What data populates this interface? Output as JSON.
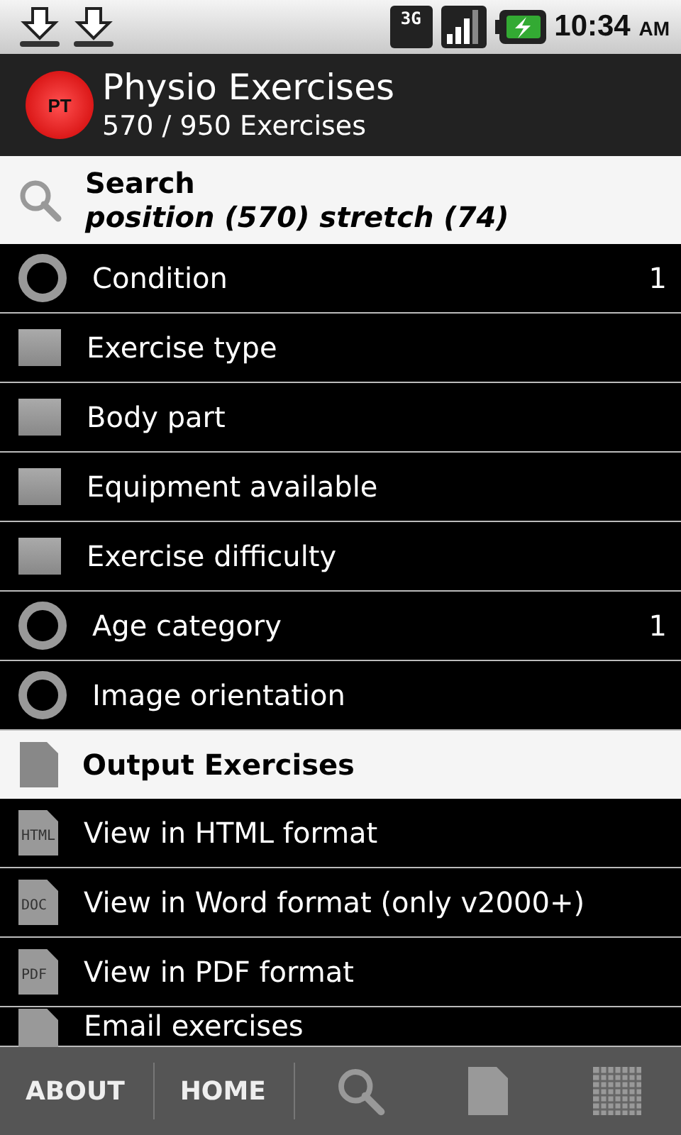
{
  "status_bar": {
    "network": "3G",
    "time": "10:34",
    "period": "AM"
  },
  "app_bar": {
    "title": "Physio Exercises",
    "subtitle": "570 / 950 Exercises",
    "logo": "PT"
  },
  "search": {
    "title": "Search",
    "query": "position (570) stretch (74)"
  },
  "filters": [
    {
      "kind": "radio",
      "label": "Condition",
      "count": "1"
    },
    {
      "kind": "square",
      "label": "Exercise type"
    },
    {
      "kind": "square",
      "label": "Body part"
    },
    {
      "kind": "square",
      "label": "Equipment available"
    },
    {
      "kind": "square",
      "label": "Exercise difficulty"
    },
    {
      "kind": "radio",
      "label": "Age category",
      "count": "1"
    },
    {
      "kind": "radio",
      "label": "Image orientation"
    }
  ],
  "output": {
    "title": "Output Exercises",
    "items": [
      {
        "label": "View in HTML format",
        "file": "HTML"
      },
      {
        "label": "View in Word format (only v2000+)",
        "file": "DOC"
      },
      {
        "label": "View in PDF format",
        "file": "PDF"
      },
      {
        "label": "Email exercises"
      }
    ]
  },
  "bottom_bar": {
    "buttons": [
      "ABOUT",
      "HOME"
    ]
  }
}
